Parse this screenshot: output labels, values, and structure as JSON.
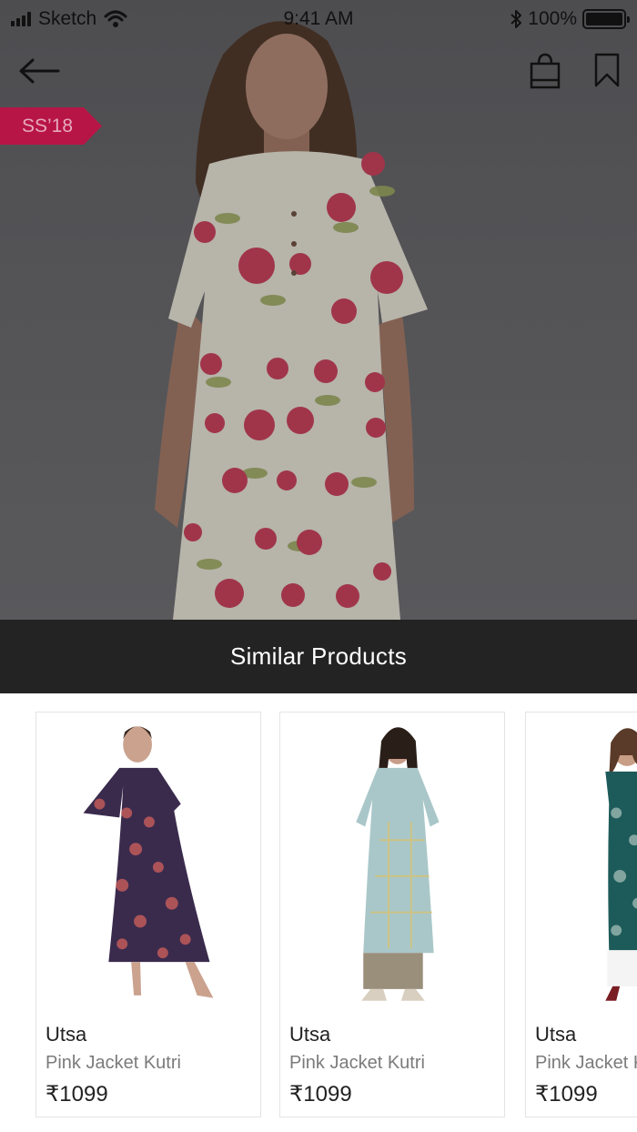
{
  "status_bar": {
    "carrier": "Sketch",
    "time": "9:41 AM",
    "battery_percent": "100%",
    "battery_level": 1.0
  },
  "header": {
    "icons": {
      "back": "arrow-left-icon",
      "bag": "shopping-bag-icon",
      "bookmark": "bookmark-icon"
    }
  },
  "product": {
    "season_tag": "SS’18"
  },
  "similar": {
    "title": "Similar Products",
    "items": [
      {
        "brand": "Utsa",
        "name": "Pink Jacket Kutri",
        "price": "₹1099",
        "dress_color": "#3a2b4d"
      },
      {
        "brand": "Utsa",
        "name": "Pink Jacket Kutri",
        "price": "₹1099",
        "dress_color": "#a9c7c9"
      },
      {
        "brand": "Utsa",
        "name": "Pink Jacket Kutri",
        "price": "₹1099",
        "dress_color": "#1d5b5a"
      }
    ]
  },
  "colors": {
    "accent": "#b81547",
    "bar": "#232323"
  }
}
